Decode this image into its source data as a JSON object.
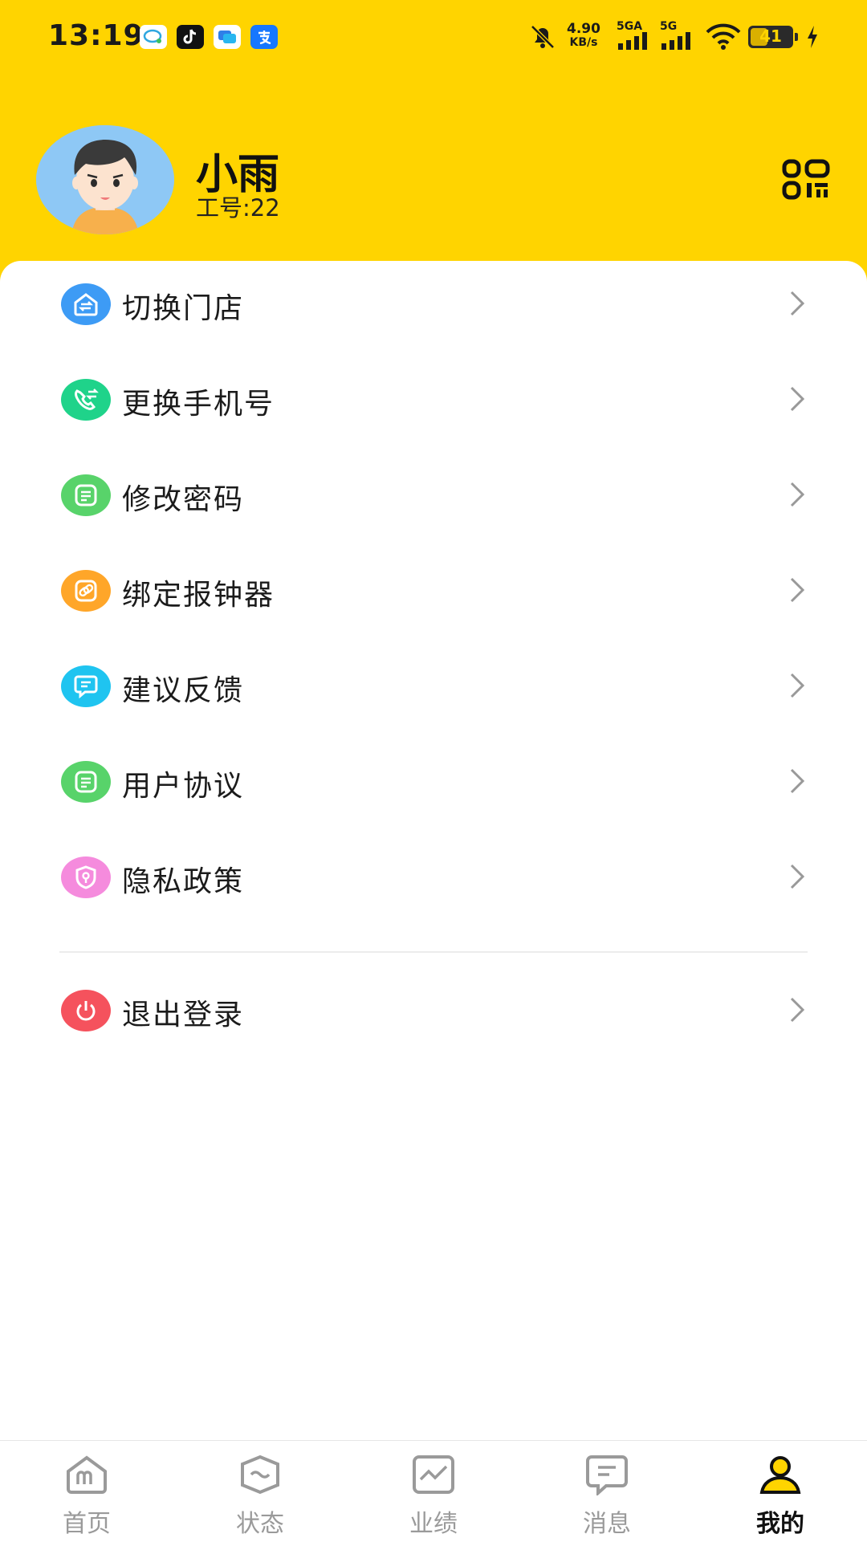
{
  "status_bar": {
    "time": "13:19",
    "speed_value": "4.90",
    "speed_unit": "KB/s",
    "network_1": "5GA",
    "network_2": "5G",
    "battery": "41"
  },
  "profile": {
    "name": "小雨",
    "staff_id": "工号:22"
  },
  "menu": [
    {
      "label": "切换门店",
      "icon": "store-switch-icon",
      "color": "#3D9BF5"
    },
    {
      "label": "更换手机号",
      "icon": "phone-change-icon",
      "color": "#1FD38A"
    },
    {
      "label": "修改密码",
      "icon": "edit-document-icon",
      "color": "#58D36A"
    },
    {
      "label": "绑定报钟器",
      "icon": "link-icon",
      "color": "#FFA629"
    },
    {
      "label": "建议反馈",
      "icon": "feedback-icon",
      "color": "#1FC4F0"
    },
    {
      "label": "用户协议",
      "icon": "agreement-icon",
      "color": "#58D36A"
    },
    {
      "label": "隐私政策",
      "icon": "privacy-shield-icon",
      "color": "#F58BDD"
    }
  ],
  "logout": {
    "label": "退出登录",
    "icon": "power-icon",
    "color": "#F5525D"
  },
  "tabs": [
    {
      "label": "首页",
      "icon": "home-icon"
    },
    {
      "label": "状态",
      "icon": "status-icon"
    },
    {
      "label": "业绩",
      "icon": "performance-chart-icon"
    },
    {
      "label": "消息",
      "icon": "message-icon"
    },
    {
      "label": "我的",
      "icon": "profile-icon",
      "active": true
    }
  ],
  "colors": {
    "header_bg": "#FFD400",
    "active_tab": "#FFD400"
  }
}
